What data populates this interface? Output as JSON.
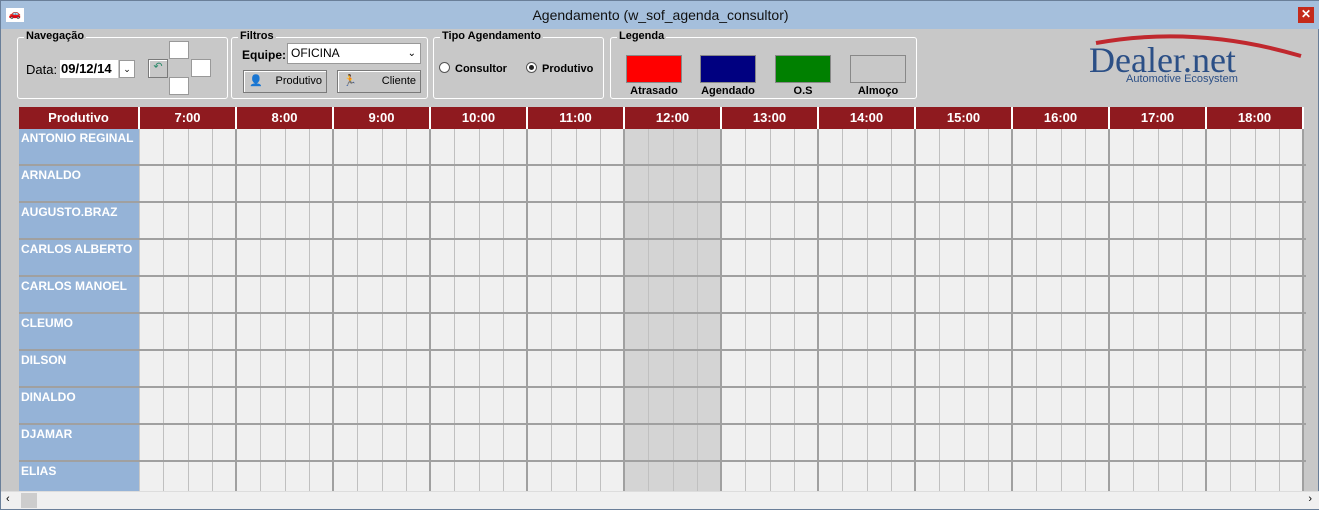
{
  "window": {
    "title": "Agendamento (w_sof_agenda_consultor)",
    "close": "✕"
  },
  "navegacao": {
    "legend": "Navegação",
    "date_label": "Data:",
    "date_value": "09/12/14"
  },
  "filtros": {
    "legend": "Filtros",
    "equipe_label": "Equipe:",
    "equipe_value": "OFICINA",
    "produtivo_button": "Produtivo",
    "cliente_button": "Cliente"
  },
  "tipo": {
    "legend": "Tipo Agendamento",
    "options": [
      {
        "label": "Consultor",
        "selected": false
      },
      {
        "label": "Produtivo",
        "selected": true
      }
    ]
  },
  "legenda": {
    "legend": "Legenda",
    "items": [
      {
        "label": "Atrasado",
        "color": "#ff0000"
      },
      {
        "label": "Agendado",
        "color": "#000080"
      },
      {
        "label": "O.S",
        "color": "#008000"
      },
      {
        "label": "Almoço",
        "color": "#c8c8c8"
      }
    ]
  },
  "logo": {
    "name": "Dealer.net",
    "tagline": "Automotive Ecosystem"
  },
  "grid": {
    "header": "Produtivo",
    "hours": [
      "7:00",
      "8:00",
      "9:00",
      "10:00",
      "11:00",
      "12:00",
      "13:00",
      "14:00",
      "15:00",
      "16:00",
      "17:00",
      "18:00"
    ],
    "lunch_hour": "12:00",
    "rows": [
      "ANTONIO REGINAL",
      "ARNALDO",
      "AUGUSTO.BRAZ",
      "CARLOS ALBERTO",
      "CARLOS MANOEL",
      "CLEUMO",
      "DILSON",
      "DINALDO",
      "DJAMAR",
      "ELIAS"
    ]
  }
}
